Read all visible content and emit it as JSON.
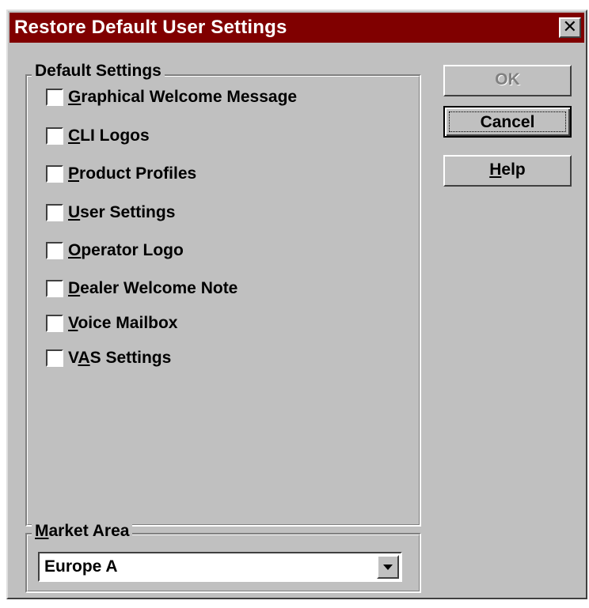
{
  "window": {
    "title": "Restore Default User Settings",
    "close_symbol": "✕"
  },
  "default_settings": {
    "legend": "Default Settings",
    "items": [
      {
        "pre": "",
        "mnemonic": "G",
        "post": "raphical Welcome Message",
        "checked": false
      },
      {
        "pre": "",
        "mnemonic": "C",
        "post": "LI Logos",
        "checked": false
      },
      {
        "pre": "",
        "mnemonic": "P",
        "post": "roduct Profiles",
        "checked": false
      },
      {
        "pre": "",
        "mnemonic": "U",
        "post": "ser Settings",
        "checked": false
      },
      {
        "pre": "",
        "mnemonic": "O",
        "post": "perator Logo",
        "checked": false
      },
      {
        "pre": "",
        "mnemonic": "D",
        "post": "ealer Welcome Note",
        "checked": false
      },
      {
        "pre": "",
        "mnemonic": "V",
        "post": "oice Mailbox",
        "checked": false
      },
      {
        "pre": "V",
        "mnemonic": "A",
        "post": "S Settings",
        "checked": false
      }
    ]
  },
  "buttons": {
    "ok": "OK",
    "cancel": "Cancel",
    "help_mnemonic": "H",
    "help_rest": "elp"
  },
  "market_area": {
    "legend_mnemonic": "M",
    "legend_rest": "arket Area",
    "selected": "Europe A"
  },
  "colors": {
    "titlebar": "#800000",
    "face": "#c0c0c0"
  }
}
